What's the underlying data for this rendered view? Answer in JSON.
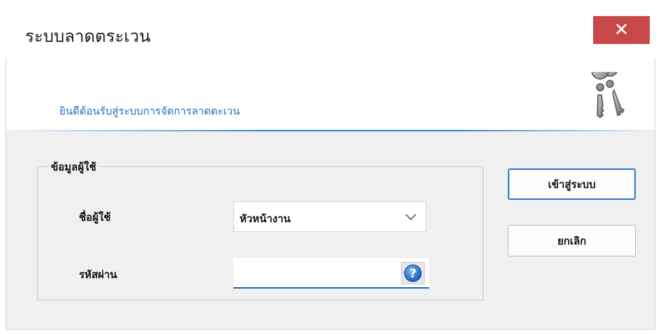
{
  "window": {
    "title": "ระบบลาดตระเวน",
    "close_glyph": "✕"
  },
  "banner": {
    "welcome_text": "ยินดีต้อนรับสู่ระบบการจัดการลาดตะเวน",
    "icon": "keys-icon"
  },
  "user_info": {
    "group_label": "ข้อมูลผู้ใช้",
    "username_label": "ชื่อผู้ใช้",
    "username_value": "หัวหน้างาน",
    "password_label": "รหัสผ่าน",
    "password_value": ""
  },
  "buttons": {
    "login_label": "เข้าสู่ระบบ",
    "cancel_label": "ยกเลิก"
  },
  "colors": {
    "close_button": "#c8484a",
    "welcome_text": "#1c6fc4",
    "accent_border": "#2a74d0"
  }
}
